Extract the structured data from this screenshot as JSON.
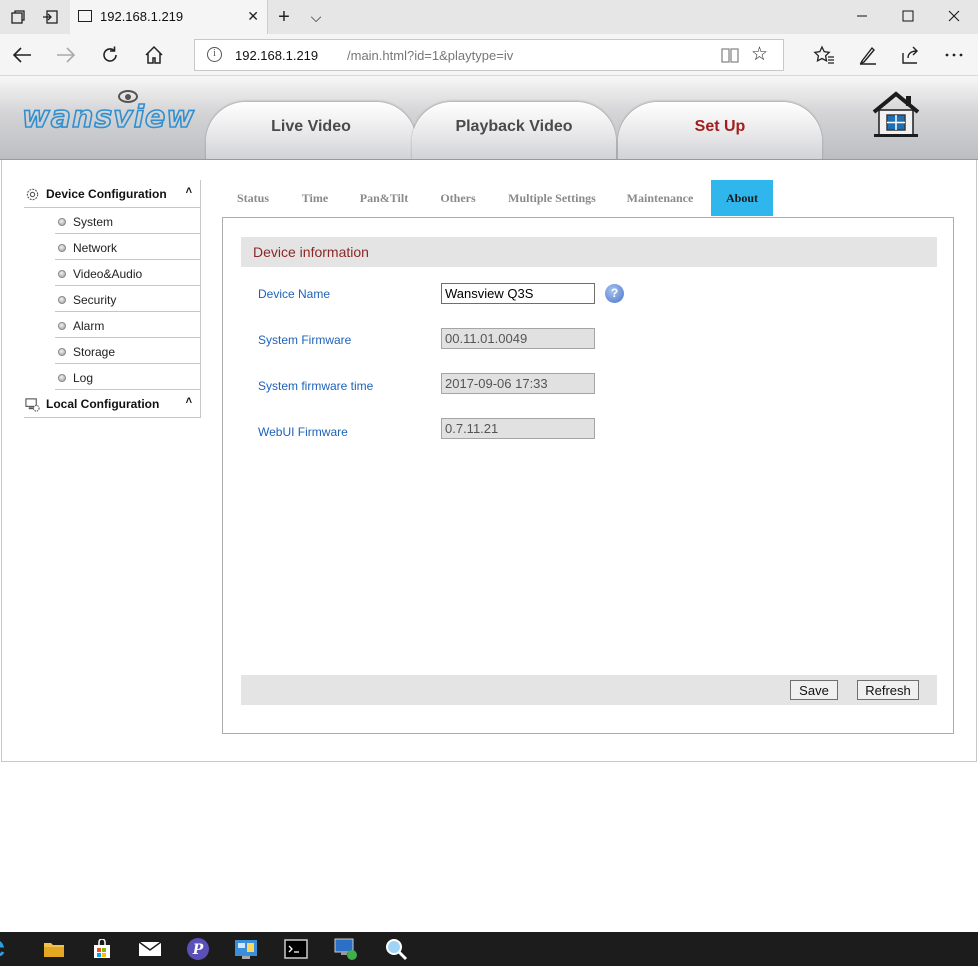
{
  "browser": {
    "tab_title": "192.168.1.219",
    "new_tab": "+",
    "tab_menu": "⌵",
    "close": "✕",
    "address_host": "192.168.1.219",
    "address_path": "/main.html?id=1&playtype=iv"
  },
  "app": {
    "logo": "wansview",
    "main_tabs": [
      "Live Video",
      "Playback Video",
      "Set Up"
    ],
    "active_main_tab": "Set Up"
  },
  "sidebar": {
    "device_config": {
      "label": "Device Configuration",
      "items": [
        "System",
        "Network",
        "Video&Audio",
        "Security",
        "Alarm",
        "Storage",
        "Log"
      ]
    },
    "local_config": {
      "label": "Local Configuration"
    }
  },
  "subtabs": [
    "Status",
    "Time",
    "Pan&Tilt",
    "Others",
    "Multiple Settings",
    "Maintenance",
    "About"
  ],
  "active_subtab": "About",
  "device_info": {
    "title": "Device information",
    "rows": [
      {
        "label": "Device Name",
        "value": "Wansview Q3S"
      },
      {
        "label": "System Firmware",
        "value": "00.11.01.0049"
      },
      {
        "label": "System firmware time",
        "value": "2017-09-06 17:33"
      },
      {
        "label": "WebUI Firmware",
        "value": "0.7.11.21"
      }
    ],
    "help": "?"
  },
  "buttons": {
    "save": "Save",
    "refresh": "Refresh"
  },
  "colors": {
    "accent_tab": "#2fb6ec",
    "label_blue": "#1e62b8",
    "active_tab_text": "#a01e1e",
    "section_title": "#8b2828"
  }
}
